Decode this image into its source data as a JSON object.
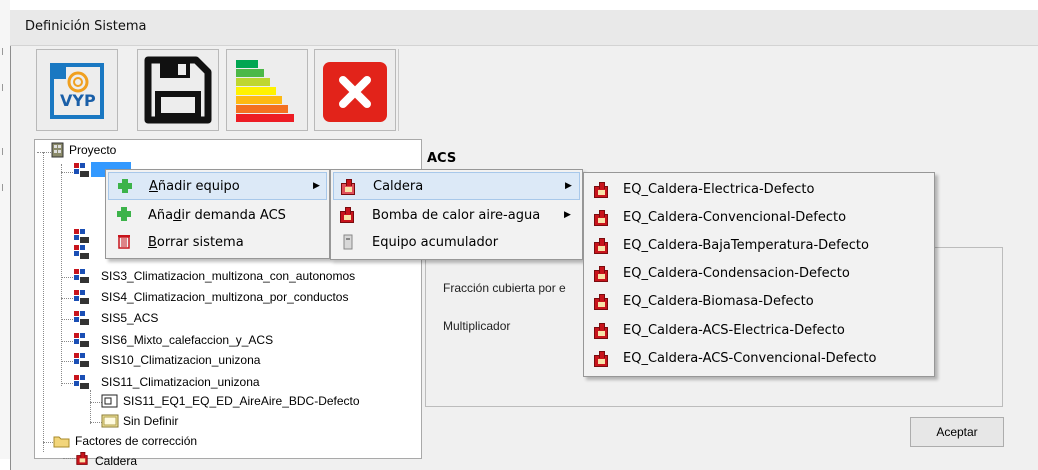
{
  "window": {
    "title": "Definición Sistema"
  },
  "toolbar": {
    "buttons": [
      {
        "icon": "vyp-logo-icon"
      },
      {
        "icon": "save-icon"
      },
      {
        "icon": "energy-rating-icon"
      },
      {
        "icon": "close-icon"
      }
    ]
  },
  "tree": {
    "root_label": "Proyecto",
    "items": [
      "SIS3_Climatizacion_multizona_con_autonomos",
      "SIS4_Climatizacion_multizona_por_conductos",
      "SIS5_ACS",
      "SIS6_Mixto_calefaccion_y_ACS",
      "SIS10_Climatizacion_unizona",
      "SIS11_Climatizacion_unizona"
    ],
    "sub_equipment": "SIS11_EQ1_EQ_ED_AireAire_BDC-Defecto",
    "undefined_label": "Sin Definir",
    "factors_label": "Factores de corrección",
    "partial_next": "Caldera"
  },
  "panel": {
    "heading": "ACS",
    "fraction_label": "Fracción cubierta por e",
    "multiplier_label": "Multiplicador",
    "accept_label": "Aceptar"
  },
  "context_menu": {
    "items": [
      {
        "label": "Añadir equipo",
        "underline": "A"
      },
      {
        "label": "Añadir demanda ACS",
        "underline": "d"
      },
      {
        "label": "Borrar sistema",
        "underline": "B"
      }
    ]
  },
  "submenu": {
    "items": [
      "Caldera",
      "Bomba de calor aire-agua",
      "Equipo acumulador"
    ]
  },
  "caldera_menu": {
    "items": [
      "EQ_Caldera-Electrica-Defecto",
      "EQ_Caldera-Convencional-Defecto",
      "EQ_Caldera-BajaTemperatura-Defecto",
      "EQ_Caldera-Condensacion-Defecto",
      "EQ_Caldera-Biomasa-Defecto",
      "EQ_Caldera-ACS-Electrica-Defecto",
      "EQ_Caldera-ACS-Convencional-Defecto"
    ]
  },
  "colors": {
    "accent_red": "#c8141c",
    "highlight": "#dce9f7",
    "delete_red": "#e2231a"
  }
}
